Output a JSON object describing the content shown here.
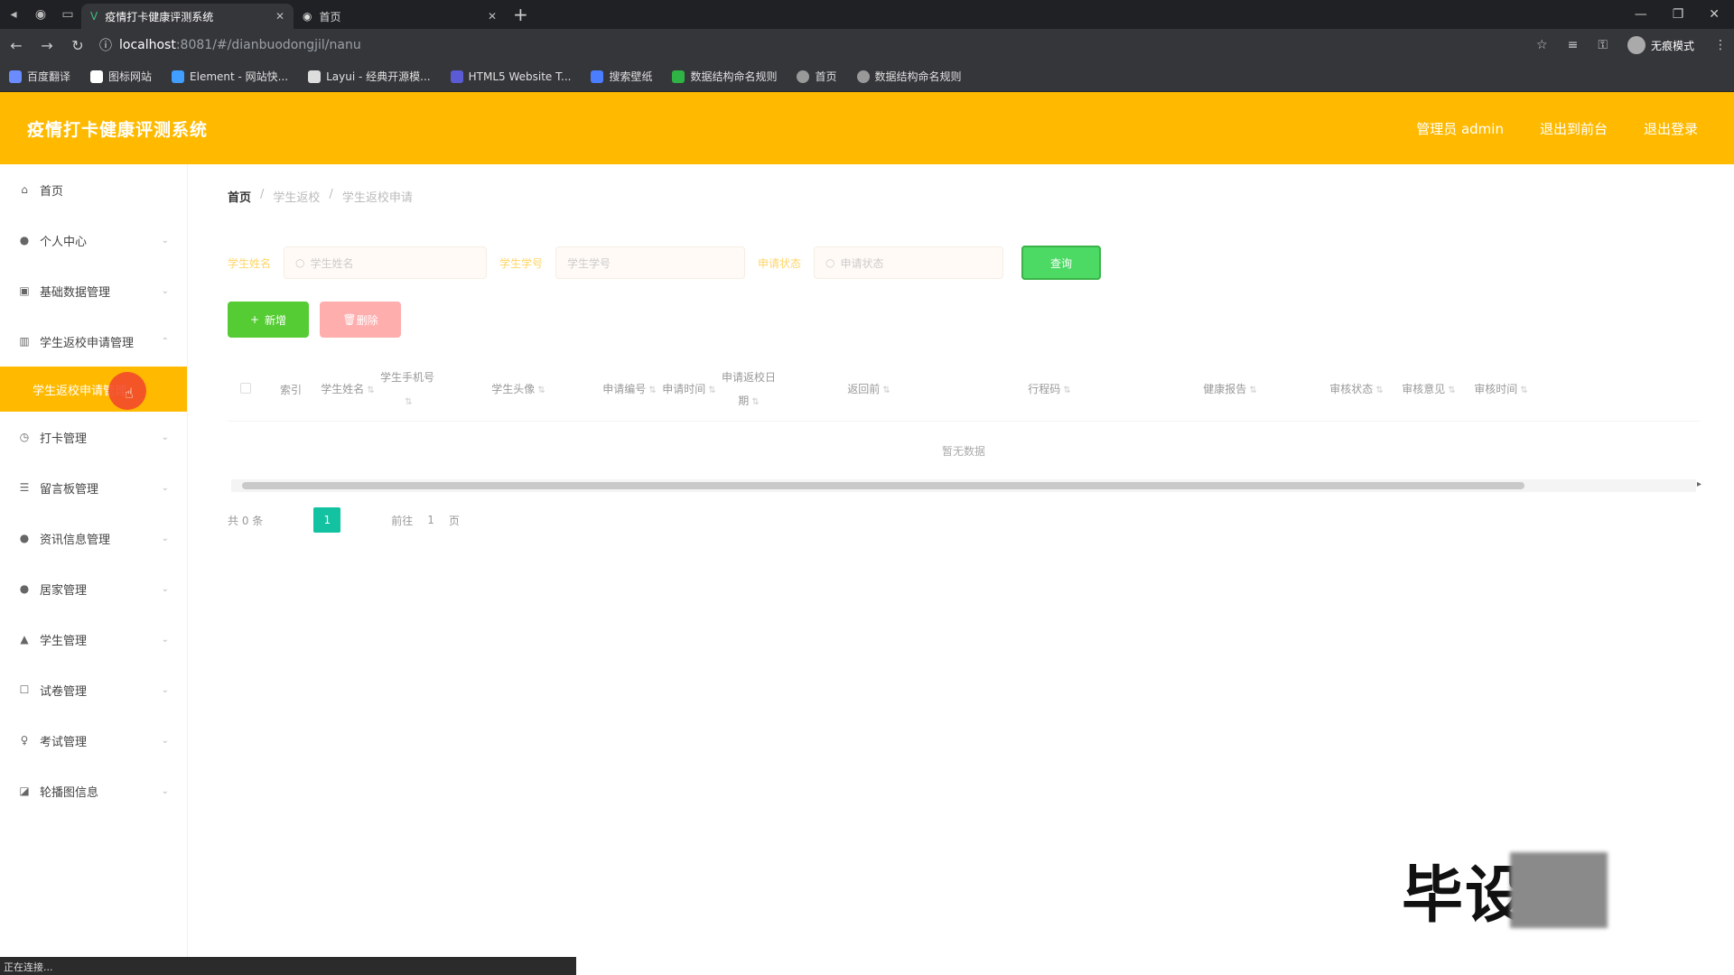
{
  "browser": {
    "tabs": [
      {
        "title": "疫情打卡健康评测系统",
        "active": true
      },
      {
        "title": "首页",
        "active": false
      }
    ],
    "url_host": "localhost",
    "url_path": ":8081/#/dianbuodongjil/nanu",
    "profile_label": "无痕模式"
  },
  "bookmarks": [
    "百度翻译",
    "图标网站",
    "Element - 网站快...",
    "Layui - 经典开源模...",
    "HTML5 Website T...",
    "搜索壁纸",
    "数据结构命名规则",
    "首页",
    "数据结构命名规则"
  ],
  "header": {
    "title": "疫情打卡健康评测系统",
    "user": "管理员 admin",
    "front_link": "退出到前台",
    "logout": "退出登录"
  },
  "sidebar": {
    "items": [
      {
        "label": "首页",
        "icon": "home-icon",
        "expandable": false
      },
      {
        "label": "个人中心",
        "icon": "user-icon",
        "expandable": true
      },
      {
        "label": "基础数据管理",
        "icon": "data-icon",
        "expandable": true
      },
      {
        "label": "学生返校申请管理",
        "icon": "chart-icon",
        "expandable": true
      }
    ],
    "active_sub": "学生返校申请管理",
    "items_after": [
      {
        "label": "打卡管理",
        "icon": "clock-icon"
      },
      {
        "label": "留言板管理",
        "icon": "message-icon"
      },
      {
        "label": "资讯信息管理",
        "icon": "news-icon"
      },
      {
        "label": "居家管理",
        "icon": "home-user-icon"
      },
      {
        "label": "学生管理",
        "icon": "student-icon"
      },
      {
        "label": "试卷管理",
        "icon": "paper-icon"
      },
      {
        "label": "考试管理",
        "icon": "exam-icon"
      },
      {
        "label": "轮播图信息",
        "icon": "image-icon"
      }
    ]
  },
  "breadcrumb": {
    "home": "首页",
    "level1": "学生返校",
    "level2": "学生返校申请"
  },
  "search": {
    "field1_label": "学生姓名",
    "field1_placeholder": "学生姓名",
    "field2_label": "学生学号",
    "field2_placeholder": "学生学号",
    "field3_label": "申请状态",
    "field3_placeholder": "申请状态",
    "button": "查询"
  },
  "actions": {
    "add": "新增",
    "delete": "删除"
  },
  "table": {
    "columns": [
      {
        "label": "索引",
        "w": 60
      },
      {
        "label": "学生姓名",
        "w": 66
      },
      {
        "label": "学生手机号",
        "w": 66
      },
      {
        "label": "学生头像",
        "w": 180
      },
      {
        "label": "申请编号",
        "w": 66
      },
      {
        "label": "申请时间",
        "w": 66
      },
      {
        "label": "申请返校日期",
        "w": 66
      },
      {
        "label": "返回前",
        "w": 200
      },
      {
        "label": "行程码",
        "w": 200
      },
      {
        "label": "健康报告",
        "w": 200
      },
      {
        "label": "审核状态",
        "w": 80
      },
      {
        "label": "审核意见",
        "w": 80
      },
      {
        "label": "审核时间",
        "w": 80
      }
    ],
    "empty_text": "暂无数据"
  },
  "pagination": {
    "total": "共 0 条",
    "current": "1",
    "goto_label": "前往",
    "goto_value": "1",
    "page_suffix": "页"
  },
  "watermark": "毕设",
  "statusbar": "正在连接..."
}
